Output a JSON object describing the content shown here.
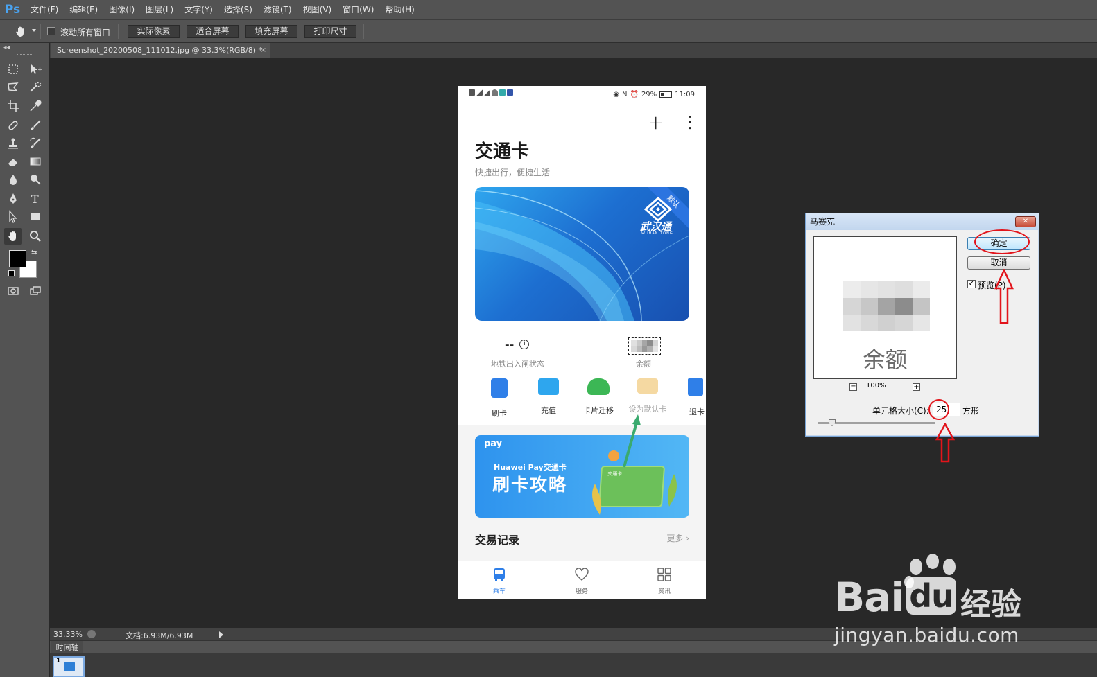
{
  "app": {
    "logo": "Ps"
  },
  "menu": [
    "文件(F)",
    "编辑(E)",
    "图像(I)",
    "图层(L)",
    "文字(Y)",
    "选择(S)",
    "滤镜(T)",
    "视图(V)",
    "窗口(W)",
    "帮助(H)"
  ],
  "options": {
    "scroll_all": "滚动所有窗口",
    "actual_pixels": "实际像素",
    "fit_screen": "适合屏幕",
    "fill_screen": "填充屏幕",
    "print_size": "打印尺寸"
  },
  "document": {
    "tab_title": "Screenshot_20200508_111012.jpg @ 33.3%(RGB/8) *",
    "tab_close": "×"
  },
  "phone": {
    "status": {
      "battery": "29%",
      "time": "11:09"
    },
    "title": "交通卡",
    "subtitle": "快捷出行，便捷生活",
    "card": {
      "badge": "默认",
      "brand": "武汉通",
      "brand_en": "WUHAN TONG"
    },
    "metro_value": "--",
    "metro_label": "地铁出入闸状态",
    "balance_label": "余额",
    "actions": [
      {
        "label": "刷卡",
        "color": "#2f7fe8"
      },
      {
        "label": "充值",
        "color": "#2ea6ee"
      },
      {
        "label": "卡片迁移",
        "color": "#3cb755"
      },
      {
        "label": "设为默认卡",
        "color": "#f3c46b"
      },
      {
        "label": "退卡",
        "color": "#2f7fe8"
      }
    ],
    "banner": {
      "pay": "pay",
      "sub": "Huawei Pay交通卡",
      "title": "刷卡攻略",
      "card_label": "交通卡"
    },
    "transactions": {
      "title": "交易记录",
      "more": "更多"
    },
    "nav": [
      {
        "label": "乘车",
        "color": "#2f7fe8"
      },
      {
        "label": "服务",
        "color": "#666666"
      },
      {
        "label": "资讯",
        "color": "#666666"
      }
    ]
  },
  "dialog": {
    "title": "马赛克",
    "close": "✕",
    "preview_text": "余额",
    "zoom_out": "−",
    "zoom_in": "+",
    "zoom": "100%",
    "ok": "确定",
    "cancel": "取消",
    "preview_checkbox": "预览(P)",
    "preview_checked": true,
    "cell_size_label": "单元格大小(C):",
    "cell_size_value": "25",
    "cell_size_unit": "方形"
  },
  "statusbar": {
    "zoom": "33.33%",
    "doc_size": "文档:6.93M/6.93M"
  },
  "timeline": {
    "tab": "时间轴",
    "frame": "1"
  },
  "watermark": {
    "brand": "Bai",
    "brand2": "du",
    "cn": "经验",
    "url": "jingyan.baidu.com"
  }
}
